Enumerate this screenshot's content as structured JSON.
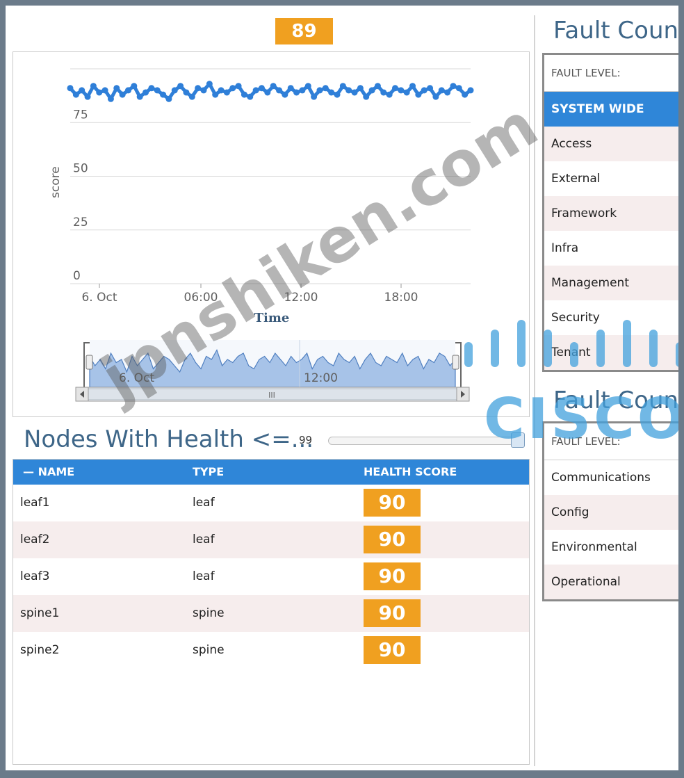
{
  "health": {
    "current_score": "89",
    "chart": {
      "ylabel": "score",
      "xlabel": "Time",
      "y_ticks": [
        "0",
        "25",
        "50",
        "75"
      ],
      "x_ticks": [
        "6. Oct",
        "06:00",
        "12:00",
        "18:00"
      ],
      "navigator_labels": [
        "6. Oct",
        "12:00"
      ],
      "scrollbar_grip": "III"
    }
  },
  "chart_data": {
    "type": "line",
    "title": "",
    "xlabel": "Time",
    "ylabel": "score",
    "ylim": [
      0,
      100
    ],
    "x_ticks": [
      "6. Oct",
      "06:00",
      "12:00",
      "18:00"
    ],
    "series": [
      {
        "values": [
          91,
          88,
          90,
          87,
          92,
          89,
          90,
          86,
          91,
          88,
          90,
          92,
          87,
          89,
          91,
          90,
          88,
          86,
          90,
          92,
          89,
          87,
          91,
          90,
          93,
          88,
          90,
          89,
          91,
          92,
          88,
          87,
          90,
          91,
          89,
          92,
          90,
          88,
          91,
          89,
          90,
          92,
          87,
          90,
          91,
          89,
          88,
          92,
          90,
          89,
          91,
          87,
          90,
          92,
          89,
          88,
          91,
          90,
          89,
          92,
          88,
          90,
          91,
          87,
          90,
          89,
          92,
          91,
          88,
          90
        ]
      }
    ]
  },
  "nodes": {
    "title": "Nodes With Health <=...",
    "slider_value": "99",
    "columns": {
      "name": "— NAME",
      "type": "TYPE",
      "score": "HEALTH SCORE"
    },
    "rows": [
      {
        "name": "leaf1",
        "type": "leaf",
        "score": "90"
      },
      {
        "name": "leaf2",
        "type": "leaf",
        "score": "90"
      },
      {
        "name": "leaf3",
        "type": "leaf",
        "score": "90"
      },
      {
        "name": "spine1",
        "type": "spine",
        "score": "90"
      },
      {
        "name": "spine2",
        "type": "spine",
        "score": "90"
      }
    ]
  },
  "fault_domain": {
    "title": "Fault Coun",
    "header": "FAULT LEVEL:",
    "items": [
      "SYSTEM WIDE",
      "Access",
      "External",
      "Framework",
      "Infra",
      "Management",
      "Security",
      "Tenant"
    ]
  },
  "fault_type": {
    "title": "Fault Coun",
    "header": "FAULT LEVEL:",
    "items": [
      "Communications",
      "Config",
      "Environmental",
      "Operational"
    ]
  },
  "watermark": {
    "text": "jpnshiken.com",
    "logo_text": "CISCO"
  },
  "colors": {
    "accent": "#2f86d8",
    "badge": "#f0a020",
    "series": "#2f7fd8",
    "title": "#3e6688"
  }
}
